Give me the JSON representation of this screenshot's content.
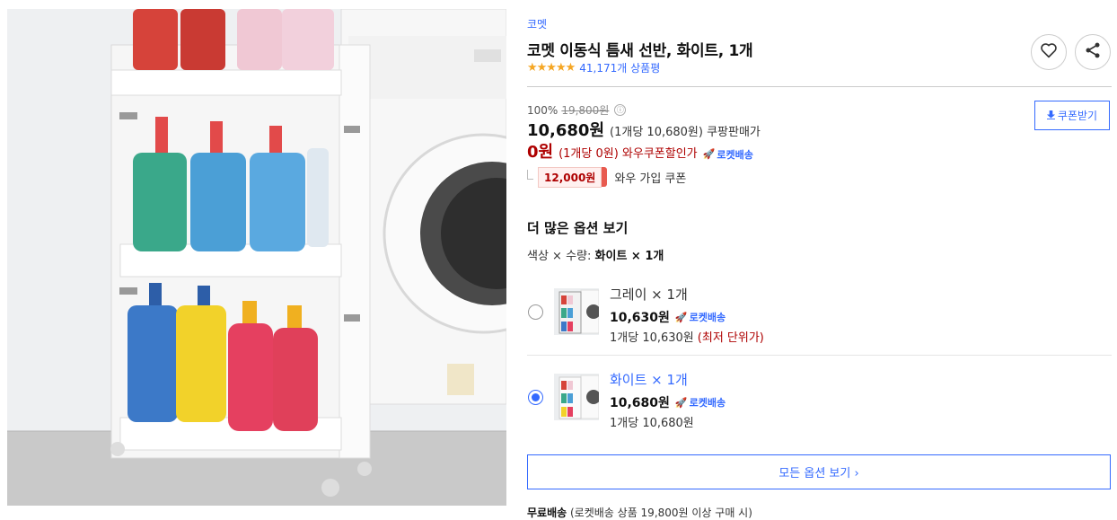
{
  "product": {
    "brand": "코멧",
    "title": "코멧 이동식 틈새 선반, 화이트, 1개",
    "rating_stars": "★★★★★",
    "rating": 4.5,
    "review_count": "41,171개 상품평"
  },
  "pricing": {
    "discount_rate": "100%",
    "original_price": "19,800원",
    "info_icon": "ⓘ",
    "sale_price": "10,680원",
    "sale_unit": "(1개당 10,680원) 쿠팡판매가",
    "wow_price": "0원",
    "wow_unit": "(1개당 0원) 와우쿠폰할인가",
    "rocket_label": "로켓배송",
    "wow_coupon_amount": "12,000원",
    "wow_coupon_label": "와우 가입 쿠폰",
    "coupon_button": "쿠폰받기"
  },
  "options": {
    "section_title": "더 많은 옵션 보기",
    "summary_prefix": "색상 × 수량:",
    "summary_value": "화이트 × 1개",
    "items": [
      {
        "name": "그레이 × 1개",
        "price": "10,630원",
        "rocket": "로켓배송",
        "unit": "1개당 10,630원",
        "note": "(최저 단위가)",
        "selected": false
      },
      {
        "name": "화이트 × 1개",
        "price": "10,680원",
        "rocket": "로켓배송",
        "unit": "1개당 10,680원",
        "note": "",
        "selected": true
      }
    ],
    "all_options_button": "모든 옵션 보기 ›"
  },
  "shipping": {
    "label": "무료배송",
    "detail": "(로켓배송 상품 19,800원 이상 구매 시)"
  },
  "icons": {
    "favorite": "heart-icon",
    "share": "share-icon",
    "rocket": "rocket-icon",
    "download": "download-icon"
  },
  "colors": {
    "accent_blue": "#346aff",
    "wow_red": "#ae0000",
    "star": "#f5a623"
  }
}
